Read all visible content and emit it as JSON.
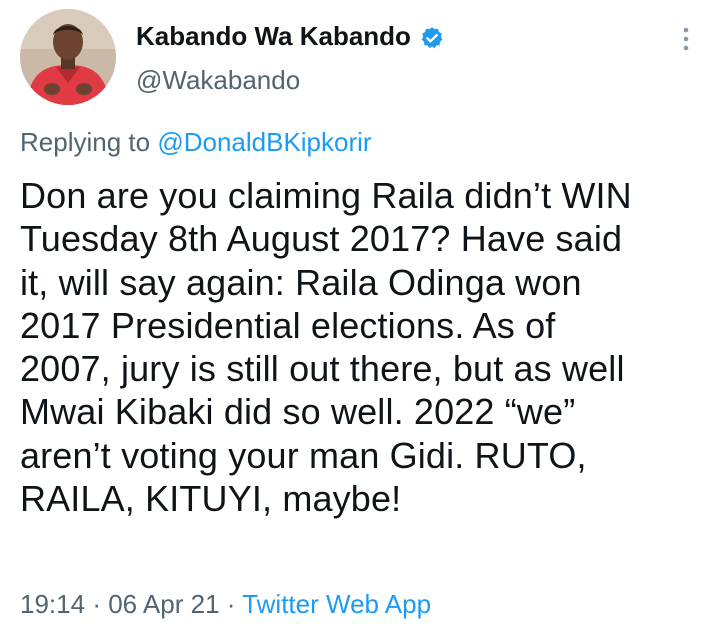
{
  "author": {
    "display_name": "Kabando Wa Kabando",
    "handle": "@Wakabando",
    "verified": true
  },
  "reply": {
    "prefix": "Replying to",
    "mention": "@DonaldBKipkorir"
  },
  "tweet": {
    "lines": [
      "Don are you claiming Raila didn’t WIN",
      "Tuesday 8th August 2017? Have said",
      "it, will say again: Raila Odinga won",
      "2017 Presidential elections. As of",
      "2007, jury is still out there, but as well",
      "Mwai Kibaki did so well. 2022 “we”",
      "aren’t voting your man Gidi. RUTO,",
      "RAILA, KITUYI, maybe!"
    ]
  },
  "meta": {
    "time": "19:14",
    "separator": "·",
    "date": "06 Apr 21",
    "source": "Twitter Web App"
  },
  "icons": {
    "verified": "verified-badge-icon",
    "more": "more-vertical-icon"
  },
  "colors": {
    "accent": "#1d9bf0",
    "text": "#0f1419",
    "secondary": "#536471"
  }
}
